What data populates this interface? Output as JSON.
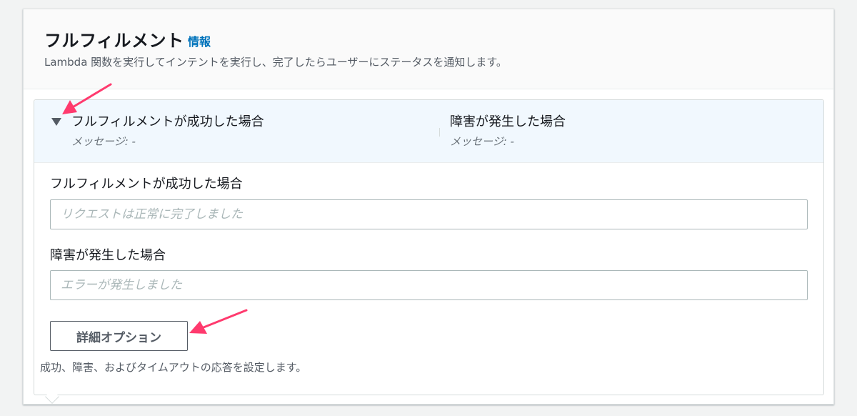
{
  "panel": {
    "title": "フルフィルメント",
    "info_link": "情報",
    "description": "Lambda 関数を実行してインテントを実行し、完了したらユーザーにステータスを通知します。"
  },
  "summary": {
    "success_title": "フルフィルメントが成功した場合",
    "success_message": "メッセージ: -",
    "failure_title": "障害が発生した場合",
    "failure_message": "メッセージ: -"
  },
  "form": {
    "success_label": "フルフィルメントが成功した場合",
    "success_placeholder": "リクエストは正常に完了しました",
    "failure_label": "障害が発生した場合",
    "failure_placeholder": "エラーが発生しました",
    "advanced_button": "詳細オプション",
    "help_text": "成功、障害、およびタイムアウトの応答を設定します。"
  },
  "colors": {
    "link": "#0073bb",
    "annotation_arrow": "#ff3a6e",
    "summary_background": "#f1f8fe"
  }
}
